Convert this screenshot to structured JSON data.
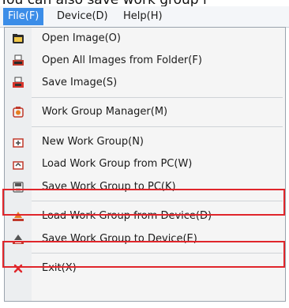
{
  "caption": "You can also save work group i",
  "menubar": {
    "items": [
      {
        "label": "File(F)",
        "active": true
      },
      {
        "label": "Device(D)",
        "active": false
      },
      {
        "label": "Help(H)",
        "active": false
      }
    ]
  },
  "file_menu": {
    "items": [
      {
        "label": "Open Image(O)",
        "icon": "folder-open-icon"
      },
      {
        "label": "Open All Images from Folder(F)",
        "icon": "folder-images-icon"
      },
      {
        "label": "Save Image(S)",
        "icon": "save-image-icon"
      },
      {
        "label": "Work Group Manager(M)",
        "icon": "work-group-manager-icon"
      },
      {
        "label": "New Work Group(N)",
        "icon": "new-work-group-icon"
      },
      {
        "label": "Load Work Group from PC(W)",
        "icon": "load-from-pc-icon"
      },
      {
        "label": "Save Work Group to PC(K)",
        "icon": "save-to-pc-icon"
      },
      {
        "label": "Load Work Group from Device(D)",
        "icon": "load-from-device-icon"
      },
      {
        "label": "Save Work Group to Device(E)",
        "icon": "save-to-device-icon"
      },
      {
        "label": "Exit(X)",
        "icon": "exit-icon"
      }
    ]
  },
  "colors": {
    "active_menu": "#3b8de8",
    "highlight_border": "#e0262b"
  }
}
